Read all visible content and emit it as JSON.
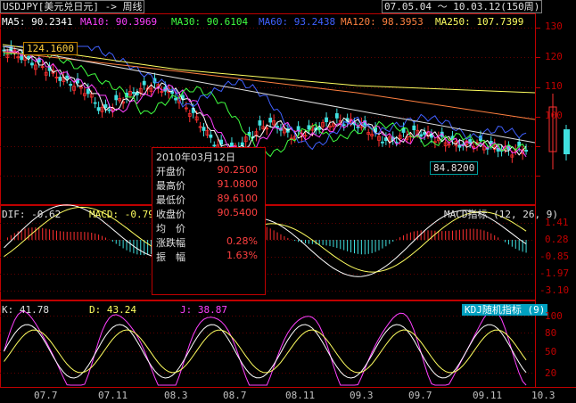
{
  "header": {
    "symbol": "USDJPY[美元兑日元] -> 周线",
    "range": "07.05.04 ～ 10.03.12(150周)"
  },
  "ma_legend": [
    {
      "label": "MA5: 90.2341",
      "color": "#ffffff"
    },
    {
      "label": "MA10: 90.3969",
      "color": "#ff40ff"
    },
    {
      "label": "MA30: 90.6104",
      "color": "#40ff40"
    },
    {
      "label": "MA60: 93.2438",
      "color": "#4060ff"
    },
    {
      "label": "MA120: 98.3953",
      "color": "#ff8040"
    },
    {
      "label": "MA250: 107.7399",
      "color": "#ffff60"
    }
  ],
  "price_axis": [
    "130",
    "120",
    "110",
    "100"
  ],
  "macd_axis": [
    "1.41",
    "0.28",
    "-0.85",
    "-1.97",
    "-3.10"
  ],
  "kdj_axis": [
    "100",
    "80",
    "50",
    "20"
  ],
  "x_axis": [
    "07.7",
    "07.11",
    "08.3",
    "08.7",
    "08.11",
    "09.3",
    "09.7",
    "09.11",
    "10.3"
  ],
  "annotations": {
    "high_tag": "124.1600",
    "low_tag": "84.8200"
  },
  "info_panel": {
    "date": "2010年03月12日",
    "rows": [
      {
        "label": "开盘价",
        "value": "90.2500"
      },
      {
        "label": "最高价",
        "value": "91.0800"
      },
      {
        "label": "最低价",
        "value": "89.6100"
      },
      {
        "label": "收盘价",
        "value": "90.5400"
      },
      {
        "label": "均　价",
        "value": ""
      },
      {
        "label": "涨跌幅",
        "value": "0.28%"
      },
      {
        "label": "振　幅",
        "value": "1.63%"
      }
    ]
  },
  "macd_panel": {
    "dif": "DIF: -0.62",
    "macd": "MACD: -0.79",
    "title": "MACD指标 (12, 26, 9)"
  },
  "kdj_panel": {
    "k": "K: 41.78",
    "d": "D: 43.24",
    "j": "J: 38.87",
    "title": "KDJ随机指标 (9)"
  },
  "colors": {
    "border": "#c00000",
    "up": "#ff3030",
    "down": "#40e0e0"
  }
}
